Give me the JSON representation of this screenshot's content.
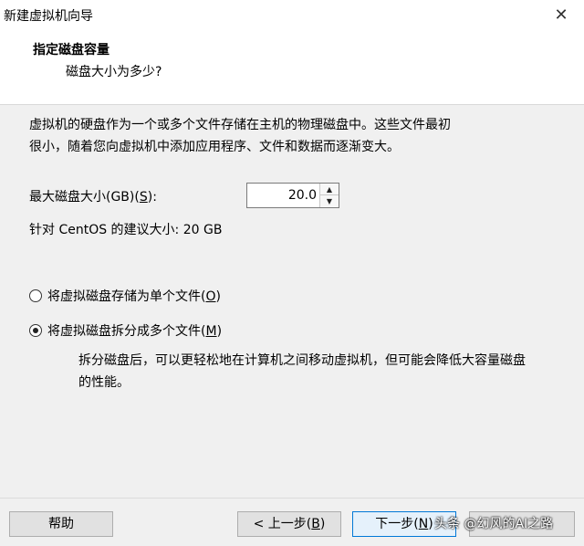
{
  "window": {
    "title": "新建虚拟机向导",
    "close_glyph": "✕"
  },
  "header": {
    "title": "指定磁盘容量",
    "subtitle": "磁盘大小为多少?"
  },
  "main": {
    "description_line1": "虚拟机的硬盘作为一个或多个文件存储在主机的物理磁盘中。这些文件最初",
    "description_line2": "很小，随着您向虚拟机中添加应用程序、文件和数据而逐渐变大。",
    "size_label_prefix": "最大磁盘大小(GB)(",
    "size_label_key": "S",
    "size_label_suffix": "):",
    "size_value": "20.0",
    "recommended": "针对 CentOS 的建议大小: 20 GB",
    "options": [
      {
        "label_prefix": "将虚拟磁盘存储为单个文件(",
        "key": "O",
        "label_suffix": ")",
        "checked": false
      },
      {
        "label_prefix": "将虚拟磁盘拆分成多个文件(",
        "key": "M",
        "label_suffix": ")",
        "checked": true
      }
    ],
    "split_desc_line1": "拆分磁盘后，可以更轻松地在计算机之间移动虚拟机，但可能会降低大容量磁盘",
    "split_desc_line2": "的性能。"
  },
  "footer": {
    "help_label": "帮助",
    "back_prefix": "< 上一步(",
    "back_key": "B",
    "back_suffix": ")",
    "next_prefix": "下一步(",
    "next_key": "N",
    "next_suffix": ")",
    "watermark": "头条 @幻风的AI之路"
  }
}
